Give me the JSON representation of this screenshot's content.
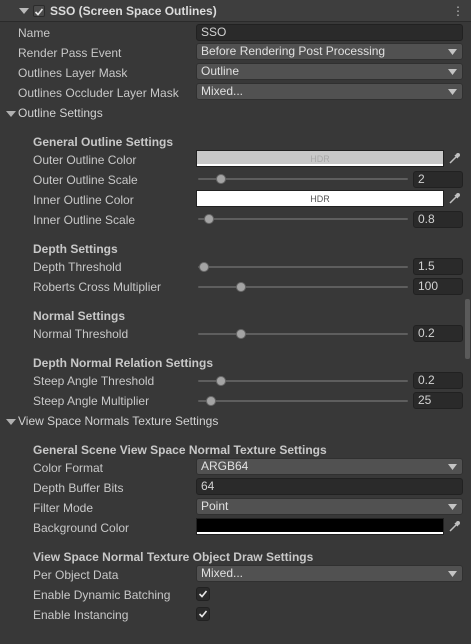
{
  "component": {
    "title": "SSO (Screen Space Outlines)",
    "enabled": true
  },
  "top_fields": {
    "name": {
      "label": "Name",
      "value": "SSO"
    },
    "render_pass_event": {
      "label": "Render Pass Event",
      "value": "Before Rendering Post Processing"
    },
    "outlines_layer_mask": {
      "label": "Outlines Layer Mask",
      "value": "Outline"
    },
    "outlines_occluder_layer_mask": {
      "label": "Outlines Occluder Layer Mask",
      "value": "Mixed..."
    }
  },
  "outline_settings": {
    "label": "Outline Settings",
    "general": {
      "header": "General Outline Settings",
      "outer_color": {
        "label": "Outer Outline Color",
        "badge": "HDR",
        "color": "#c8c8c8"
      },
      "outer_scale": {
        "label": "Outer Outline Scale",
        "value": "2",
        "level": 0.1
      },
      "inner_color": {
        "label": "Inner Outline Color",
        "badge": "HDR",
        "color": "#ffffff"
      },
      "inner_scale": {
        "label": "Inner Outline Scale",
        "value": "0.8",
        "level": 0.04
      }
    },
    "depth": {
      "header": "Depth Settings",
      "threshold": {
        "label": "Depth Threshold",
        "value": "1.5",
        "level": 0.03
      },
      "roberts": {
        "label": "Roberts Cross Multiplier",
        "value": "100",
        "level": 0.2
      }
    },
    "normal": {
      "header": "Normal Settings",
      "threshold": {
        "label": "Normal Threshold",
        "value": "0.2",
        "level": 0.2
      }
    },
    "depth_normal": {
      "header": "Depth Normal Relation Settings",
      "steep_threshold": {
        "label": "Steep Angle Threshold",
        "value": "0.2",
        "level": 0.1
      },
      "steep_multiplier": {
        "label": "Steep Angle Multiplier",
        "value": "25",
        "level": 0.06
      }
    }
  },
  "normals_settings": {
    "label": "View Space Normals Texture Settings",
    "general": {
      "header": "General Scene View Space Normal Texture Settings",
      "color_format": {
        "label": "Color Format",
        "value": "ARGB64"
      },
      "depth_buffer_bits": {
        "label": "Depth Buffer Bits",
        "value": "64"
      },
      "filter_mode": {
        "label": "Filter Mode",
        "value": "Point"
      },
      "background_color": {
        "label": "Background Color",
        "color": "#000000"
      }
    },
    "draw": {
      "header": "View Space Normal Texture Object Draw Settings",
      "per_object_data": {
        "label": "Per Object Data",
        "value": "Mixed..."
      },
      "dynamic_batching": {
        "label": "Enable Dynamic Batching",
        "checked": true
      },
      "instancing": {
        "label": "Enable Instancing",
        "checked": true
      }
    }
  },
  "icons": {
    "menu": "⋮",
    "fold": "triangle-down-icon",
    "picker": "eyedropper-icon",
    "dropdown": "chevron-down-icon",
    "check": "checkmark-icon"
  }
}
